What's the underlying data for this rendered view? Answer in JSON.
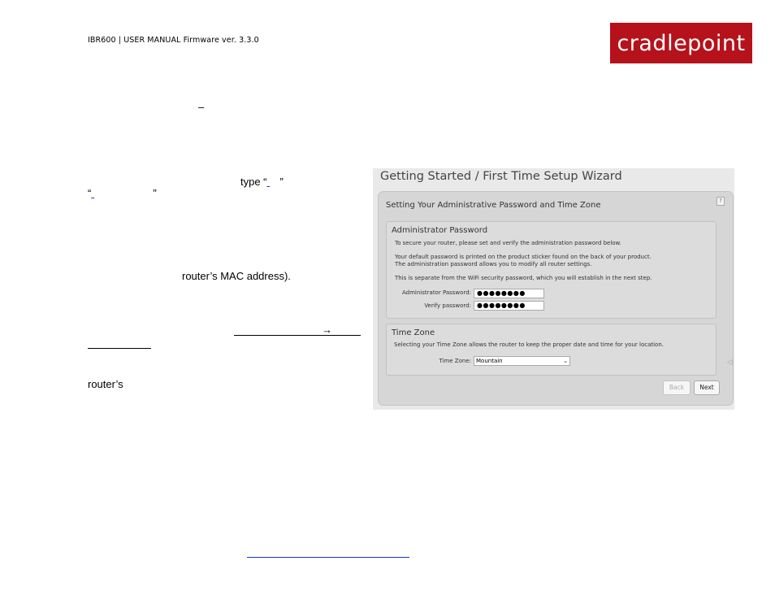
{
  "header": {
    "title": "IBR600 | USER MANUAL Firmware ver. 3.3.0",
    "logo_text": "cradlepoint",
    "logo_color": "#b5121b"
  },
  "body_text": {
    "dash": "–",
    "type_prefix": "type “",
    "type_suffix": "”",
    "quote_open": "“",
    "quote_close": "”",
    "mac_line": "router’s MAC address).",
    "arrow": "→",
    "routers": "router’s"
  },
  "wizard": {
    "title": "Getting Started / First Time Setup Wizard",
    "subtitle": "Setting Your Administrative Password and Time Zone",
    "help_icon": "?",
    "admin_section": {
      "heading": "Administrator Password",
      "line1": "To secure your router, please set and verify the administration password below.",
      "line2": "Your default password is printed on the product sticker found on the back of your product.",
      "line3": "The administration password allows you to modify all router settings.",
      "line4": "This is separate from the WiFi security password, which you will establish in the next step.",
      "password_label": "Administrator Password:",
      "password_value": "●●●●●●●●",
      "verify_label": "Verify password:",
      "verify_value": "●●●●●●●●"
    },
    "timezone_section": {
      "heading": "Time Zone",
      "description": "Selecting your Time Zone allows the router to keep the proper date and time for your location.",
      "label": "Time Zone:",
      "value": "Mountain"
    },
    "back_label": "Back",
    "next_label": "Next"
  }
}
